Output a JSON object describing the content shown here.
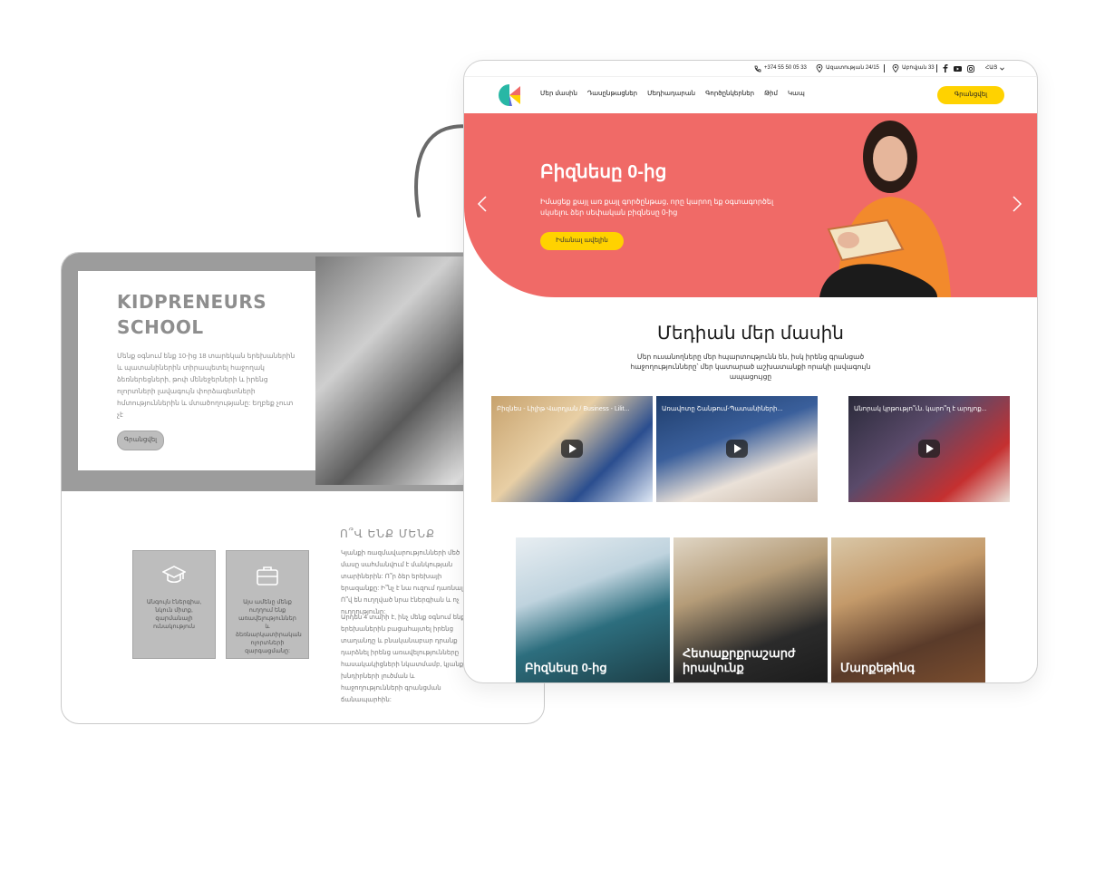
{
  "back_window": {
    "title_line1": "KIDPRENEURS",
    "title_line2": "SCHOOL",
    "description": "Մենք օգնում ենք 10-ից 18 տարեկան երեխաներին և պատանիներին տիրապետել հաջողակ ձեռներեցների, թոփ մենեջերների և իրենց ոլորտների լավագույն փորձագետների հմտություններին և մտածողությանը: Եղբեք չուտ չէ",
    "signup_button": "Գրանցվել",
    "features": [
      {
        "icon": "graduation-cap-icon",
        "text": "Անգույն էներգիա, նկուն միտք, զարմանալի ունակություն"
      },
      {
        "icon": "briefcase-icon",
        "text": "Այս ամենը մենք ուղղում ենք առավելություններ և ձեռնարկատիրական ոլորտների զարգացմանը:"
      }
    ],
    "who_heading": "Ո՞Վ ԵՆՔ ՄԵՆՔ",
    "who_paragraph1": "Կյանքի ռազմավարությունների մեծ մասը սահմանվում է մանկության տարիներին: Ո՞ր ձեր երեխայի երազանքը: Ի՞նչ է նա ուզում դառնալ: Ո՞վ են ուղղված նրա էներգիան և ոչ ուղղությունը:",
    "who_paragraph2": "Արդեն 4 տարի է, ինչ մենք օգնում ենք երեխաներին բացահայտել իրենց տաղանդը և բնականաբար դրանք դարձնել իրենց առավելությունները հասակակիցների նկատմամբ, կյանքի խնդիրների լուծման և հաջողությունների գրանցման ճանապարհին:"
  },
  "topbar": {
    "phone": "+374 55 50 05 33",
    "address1": "Ազատության 24/15",
    "address2": "Աբովյան 33",
    "language": "ՀԱՅ"
  },
  "nav": {
    "items": [
      "Մեր մասին",
      "Դասընթացներ",
      "Մեդիադարան",
      "Գործընկերներ",
      "Թիմ",
      "Կապ"
    ],
    "signup_button": "Գրանցվել"
  },
  "hero": {
    "title": "Բիզնեսը 0-ից",
    "subtitle": "Իմացեք քայլ առ քայլ գործընթաց, որը կարող եք օգտագործել սկսելու ձեր սեփական բիզնեսը 0-ից",
    "button": "Իմանալ ավելին"
  },
  "media": {
    "title": "Մեդիան մեր մասին",
    "subtitle": "Մեր ուսանողները մեր հպարտությունն են, իսկ իրենց գրանցած հաջողությունները՝ մեր կատարած աշխատանքի որակի լավագույն ապացույցը",
    "videos": [
      {
        "title": "Բիզնես - Լիլիթ Վարդյան / Business - Lilit..."
      },
      {
        "title": "Առավոտը Շանթում-Պատանիների..."
      },
      {
        "title": "Անորակ կրթությո՞ւն. կարո՞ղ է արդյոք..."
      }
    ]
  },
  "courses": [
    {
      "label": "Բիզնեսը 0-ից"
    },
    {
      "label": "Հետաքրքրաշարժ իրավունք"
    },
    {
      "label": "Մարքեթինգ"
    }
  ],
  "colors": {
    "hero_bg": "#f06a67",
    "accent_yellow": "#ffd200",
    "grey_back": "#9c9c9c"
  }
}
